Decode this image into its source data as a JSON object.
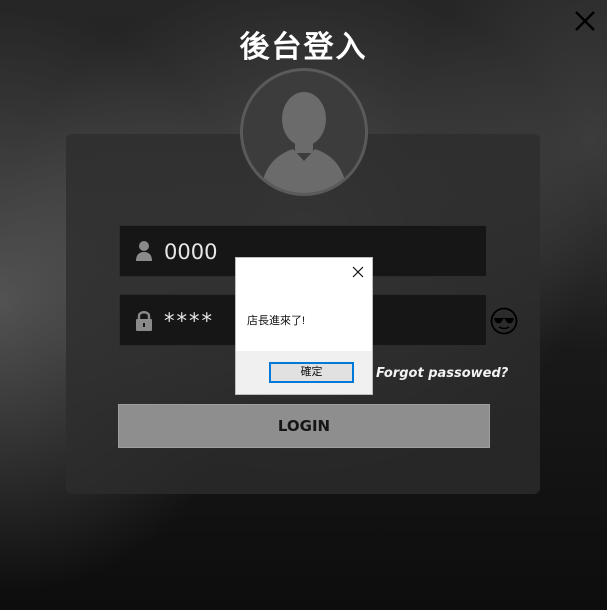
{
  "title": "後台登入",
  "username": {
    "value": "0000",
    "icon": "user-icon"
  },
  "password": {
    "value": "****",
    "icon": "lock-icon"
  },
  "show_password_icon": "sunglasses-emoji-icon",
  "forgot_link": "Forgot passowed?",
  "login_button": "LOGIN",
  "dialog": {
    "message": "店長進來了!",
    "ok_label": "確定"
  },
  "colors": {
    "panel": "#2d2d2d",
    "field": "#161616",
    "login_button": "#8e8e8e",
    "dialog_accent": "#0078d7"
  }
}
